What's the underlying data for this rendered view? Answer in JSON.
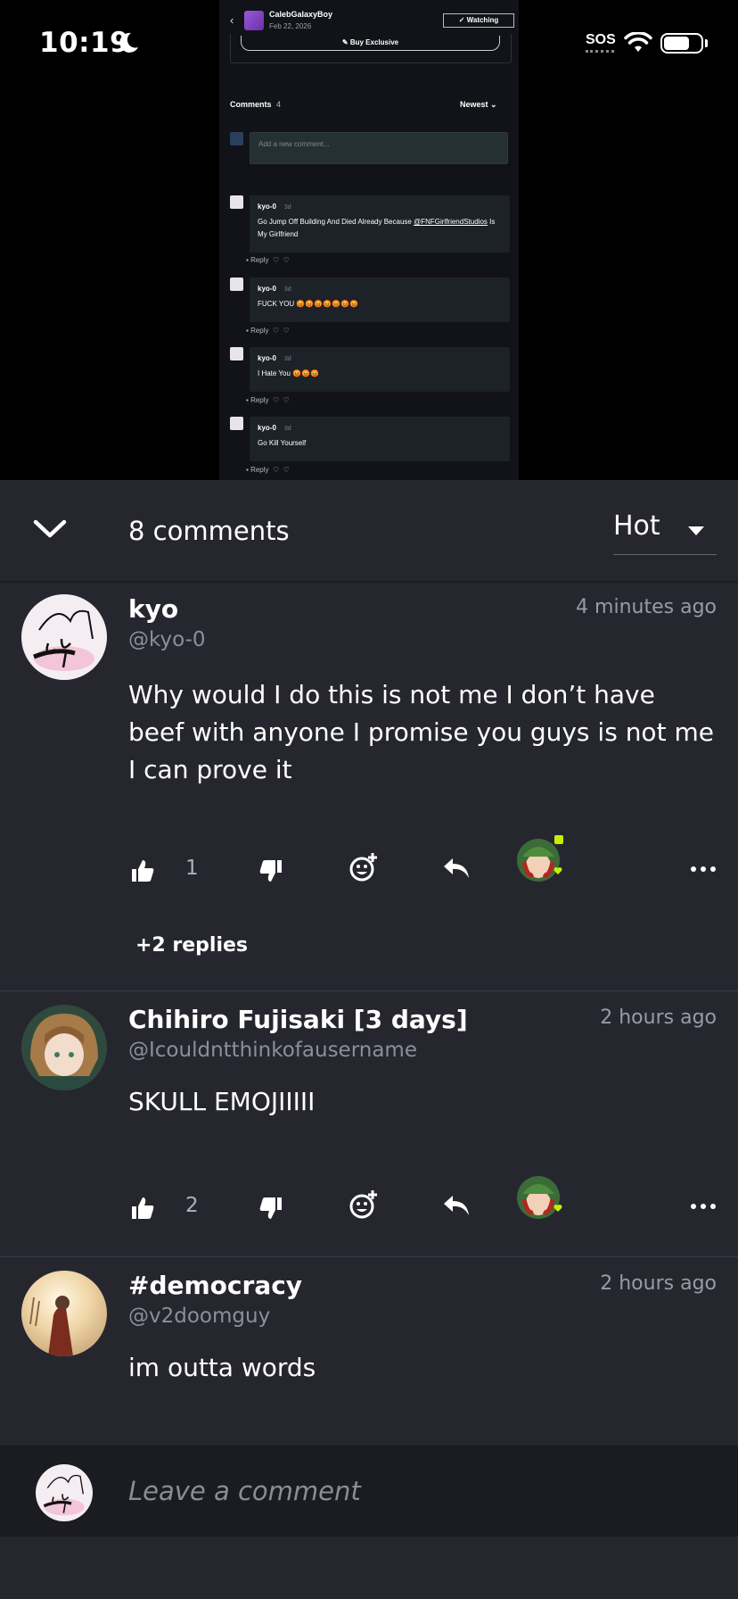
{
  "status_bar": {
    "time": "10:19",
    "sos": "SOS"
  },
  "preview": {
    "channel_name": "CalebGalaxyBoy",
    "post_date": "Feb 22, 2026",
    "watch_label": "✓ Watching",
    "buy_label": "Buy Exclusive",
    "comments_label": "Comments",
    "comments_count": "4",
    "sort_label": "Newest",
    "input_placeholder": "Add a new comment...",
    "reply_label": "Reply",
    "comments": [
      {
        "user": "kyo-0",
        "ago": "3d",
        "text_before": "Go Jump Off Building And Died Already Because ",
        "mention": "@FNFGirlfriendStudios",
        "text_after": " Is My Girlfriend"
      },
      {
        "user": "kyo-0",
        "ago": "3d",
        "text": "FUCK YOU 😡😡😡😡😡😡😡"
      },
      {
        "user": "kyo-0",
        "ago": "3d",
        "text": "I Hate You 😡😡😡"
      },
      {
        "user": "kyo-0",
        "ago": "3d",
        "text": "Go Kill Yourself"
      }
    ]
  },
  "sheet": {
    "comment_count_label": "8 comments",
    "sort_value": "Hot",
    "comments": [
      {
        "name": "kyo",
        "handle": "@kyo-0",
        "time": "4 minutes ago",
        "body": "Why would I do this is not me I don’t have beef with anyone I promise you guys is not me I can prove it",
        "likes": "1",
        "replies_label": "+2 replies"
      },
      {
        "name": "Chihiro Fujisaki [3 days]",
        "handle": "@Icouldntthinkofausername",
        "time": "2 hours ago",
        "body": "SKULL EMOJIIIII",
        "likes": "2"
      },
      {
        "name": "#democracy",
        "handle": "@v2doomguy",
        "time": "2 hours ago",
        "body": "im outta words"
      }
    ]
  },
  "compose": {
    "placeholder": "Leave a comment"
  },
  "colors": {
    "sheet_bg": "#26262f",
    "compose_bg": "#1b1b22",
    "accent_green": "#c6f000"
  }
}
